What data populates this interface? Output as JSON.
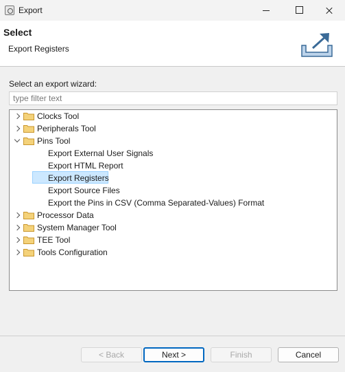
{
  "window": {
    "title": "Export"
  },
  "header": {
    "title": "Select",
    "subtitle": "Export Registers"
  },
  "wizard": {
    "label": "Select an export wizard:",
    "filter_placeholder": "type filter text",
    "filter_value": "",
    "tree": {
      "clocks_tool": "Clocks Tool",
      "peripherals_tool": "Peripherals Tool",
      "pins_tool": "Pins Tool",
      "pins_children": [
        "Export External User Signals",
        "Export HTML Report",
        "Export Registers",
        "Export Source Files",
        "Export the Pins in CSV (Comma Separated-Values) Format"
      ],
      "processor_data": "Processor Data",
      "system_manager_tool": "System Manager Tool",
      "tee_tool": "TEE Tool",
      "tools_configuration": "Tools Configuration",
      "selected": "Export Registers"
    }
  },
  "buttons": {
    "back": "< Back",
    "next": "Next >",
    "finish": "Finish",
    "cancel": "Cancel"
  },
  "colors": {
    "selection_bg": "#cce8ff",
    "selection_border": "#99d1ff",
    "default_button_border": "#0067c0",
    "folder": "#e8b84a"
  },
  "icons": {
    "app": "eclipse-app-icon",
    "header": "export-arrow-tray-icon",
    "folder": "folder-icon",
    "expand": "chevron-right-icon",
    "collapse": "chevron-down-icon"
  }
}
